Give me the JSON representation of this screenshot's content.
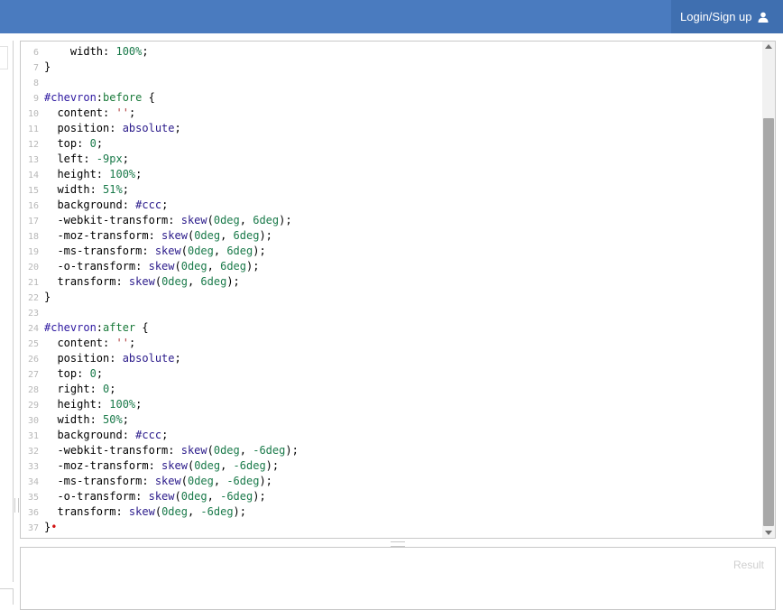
{
  "header": {
    "login_label": "Login/Sign up",
    "icon": "user-icon",
    "bar_color": "#4a7bbf",
    "login_bg": "#3f6fb0"
  },
  "editor": {
    "lines": [
      {
        "n": "6",
        "segs": [
          [
            "prop",
            "    width: "
          ],
          [
            "num",
            "100%"
          ],
          [
            "punc",
            ";"
          ]
        ]
      },
      {
        "n": "7",
        "segs": [
          [
            "punc",
            "}"
          ]
        ]
      },
      {
        "n": "8",
        "segs": []
      },
      {
        "n": "9",
        "segs": [
          [
            "sel",
            "#chevron"
          ],
          [
            "punc",
            ":"
          ],
          [
            "tag",
            "before"
          ],
          [
            "punc",
            " {"
          ]
        ]
      },
      {
        "n": "10",
        "segs": [
          [
            "prop",
            "  content: "
          ],
          [
            "str",
            "''"
          ],
          [
            "punc",
            ";"
          ]
        ]
      },
      {
        "n": "11",
        "segs": [
          [
            "prop",
            "  position: "
          ],
          [
            "val",
            "absolute"
          ],
          [
            "punc",
            ";"
          ]
        ]
      },
      {
        "n": "12",
        "segs": [
          [
            "prop",
            "  top: "
          ],
          [
            "num",
            "0"
          ],
          [
            "punc",
            ";"
          ]
        ]
      },
      {
        "n": "13",
        "segs": [
          [
            "prop",
            "  left: "
          ],
          [
            "num",
            "-9px"
          ],
          [
            "punc",
            ";"
          ]
        ]
      },
      {
        "n": "14",
        "segs": [
          [
            "prop",
            "  height: "
          ],
          [
            "num",
            "100%"
          ],
          [
            "punc",
            ";"
          ]
        ]
      },
      {
        "n": "15",
        "segs": [
          [
            "prop",
            "  width: "
          ],
          [
            "num",
            "51%"
          ],
          [
            "punc",
            ";"
          ]
        ]
      },
      {
        "n": "16",
        "segs": [
          [
            "prop",
            "  background: "
          ],
          [
            "val",
            "#ccc"
          ],
          [
            "punc",
            ";"
          ]
        ]
      },
      {
        "n": "17",
        "segs": [
          [
            "prop",
            "  -webkit-transform: "
          ],
          [
            "val",
            "skew"
          ],
          [
            "punc",
            "("
          ],
          [
            "num",
            "0deg"
          ],
          [
            "punc",
            ", "
          ],
          [
            "num",
            "6deg"
          ],
          [
            "punc",
            ");"
          ]
        ]
      },
      {
        "n": "18",
        "segs": [
          [
            "prop",
            "  -moz-transform: "
          ],
          [
            "val",
            "skew"
          ],
          [
            "punc",
            "("
          ],
          [
            "num",
            "0deg"
          ],
          [
            "punc",
            ", "
          ],
          [
            "num",
            "6deg"
          ],
          [
            "punc",
            ");"
          ]
        ]
      },
      {
        "n": "19",
        "segs": [
          [
            "prop",
            "  -ms-transform: "
          ],
          [
            "val",
            "skew"
          ],
          [
            "punc",
            "("
          ],
          [
            "num",
            "0deg"
          ],
          [
            "punc",
            ", "
          ],
          [
            "num",
            "6deg"
          ],
          [
            "punc",
            ");"
          ]
        ]
      },
      {
        "n": "20",
        "segs": [
          [
            "prop",
            "  -o-transform: "
          ],
          [
            "val",
            "skew"
          ],
          [
            "punc",
            "("
          ],
          [
            "num",
            "0deg"
          ],
          [
            "punc",
            ", "
          ],
          [
            "num",
            "6deg"
          ],
          [
            "punc",
            ");"
          ]
        ]
      },
      {
        "n": "21",
        "segs": [
          [
            "prop",
            "  transform: "
          ],
          [
            "val",
            "skew"
          ],
          [
            "punc",
            "("
          ],
          [
            "num",
            "0deg"
          ],
          [
            "punc",
            ", "
          ],
          [
            "num",
            "6deg"
          ],
          [
            "punc",
            ");"
          ]
        ]
      },
      {
        "n": "22",
        "segs": [
          [
            "punc",
            "}"
          ]
        ]
      },
      {
        "n": "23",
        "segs": []
      },
      {
        "n": "24",
        "segs": [
          [
            "sel",
            "#chevron"
          ],
          [
            "punc",
            ":"
          ],
          [
            "tag",
            "after"
          ],
          [
            "punc",
            " {"
          ]
        ]
      },
      {
        "n": "25",
        "segs": [
          [
            "prop",
            "  content: "
          ],
          [
            "str",
            "''"
          ],
          [
            "punc",
            ";"
          ]
        ]
      },
      {
        "n": "26",
        "segs": [
          [
            "prop",
            "  position: "
          ],
          [
            "val",
            "absolute"
          ],
          [
            "punc",
            ";"
          ]
        ]
      },
      {
        "n": "27",
        "segs": [
          [
            "prop",
            "  top: "
          ],
          [
            "num",
            "0"
          ],
          [
            "punc",
            ";"
          ]
        ]
      },
      {
        "n": "28",
        "segs": [
          [
            "prop",
            "  right: "
          ],
          [
            "num",
            "0"
          ],
          [
            "punc",
            ";"
          ]
        ]
      },
      {
        "n": "29",
        "segs": [
          [
            "prop",
            "  height: "
          ],
          [
            "num",
            "100%"
          ],
          [
            "punc",
            ";"
          ]
        ]
      },
      {
        "n": "30",
        "segs": [
          [
            "prop",
            "  width: "
          ],
          [
            "num",
            "50%"
          ],
          [
            "punc",
            ";"
          ]
        ]
      },
      {
        "n": "31",
        "segs": [
          [
            "prop",
            "  background: "
          ],
          [
            "val",
            "#ccc"
          ],
          [
            "punc",
            ";"
          ]
        ]
      },
      {
        "n": "32",
        "segs": [
          [
            "prop",
            "  -webkit-transform: "
          ],
          [
            "val",
            "skew"
          ],
          [
            "punc",
            "("
          ],
          [
            "num",
            "0deg"
          ],
          [
            "punc",
            ", "
          ],
          [
            "num",
            "-6deg"
          ],
          [
            "punc",
            ");"
          ]
        ]
      },
      {
        "n": "33",
        "segs": [
          [
            "prop",
            "  -moz-transform: "
          ],
          [
            "val",
            "skew"
          ],
          [
            "punc",
            "("
          ],
          [
            "num",
            "0deg"
          ],
          [
            "punc",
            ", "
          ],
          [
            "num",
            "-6deg"
          ],
          [
            "punc",
            ");"
          ]
        ]
      },
      {
        "n": "34",
        "segs": [
          [
            "prop",
            "  -ms-transform: "
          ],
          [
            "val",
            "skew"
          ],
          [
            "punc",
            "("
          ],
          [
            "num",
            "0deg"
          ],
          [
            "punc",
            ", "
          ],
          [
            "num",
            "-6deg"
          ],
          [
            "punc",
            ");"
          ]
        ]
      },
      {
        "n": "35",
        "segs": [
          [
            "prop",
            "  -o-transform: "
          ],
          [
            "val",
            "skew"
          ],
          [
            "punc",
            "("
          ],
          [
            "num",
            "0deg"
          ],
          [
            "punc",
            ", "
          ],
          [
            "num",
            "-6deg"
          ],
          [
            "punc",
            ");"
          ]
        ]
      },
      {
        "n": "36",
        "segs": [
          [
            "prop",
            "  transform: "
          ],
          [
            "val",
            "skew"
          ],
          [
            "punc",
            "("
          ],
          [
            "num",
            "0deg"
          ],
          [
            "punc",
            ", "
          ],
          [
            "num",
            "-6deg"
          ],
          [
            "punc",
            ");"
          ]
        ]
      },
      {
        "n": "37",
        "segs": [
          [
            "punc",
            "}"
          ],
          [
            "dot",
            "•"
          ]
        ]
      }
    ]
  },
  "result": {
    "label": "Result"
  }
}
